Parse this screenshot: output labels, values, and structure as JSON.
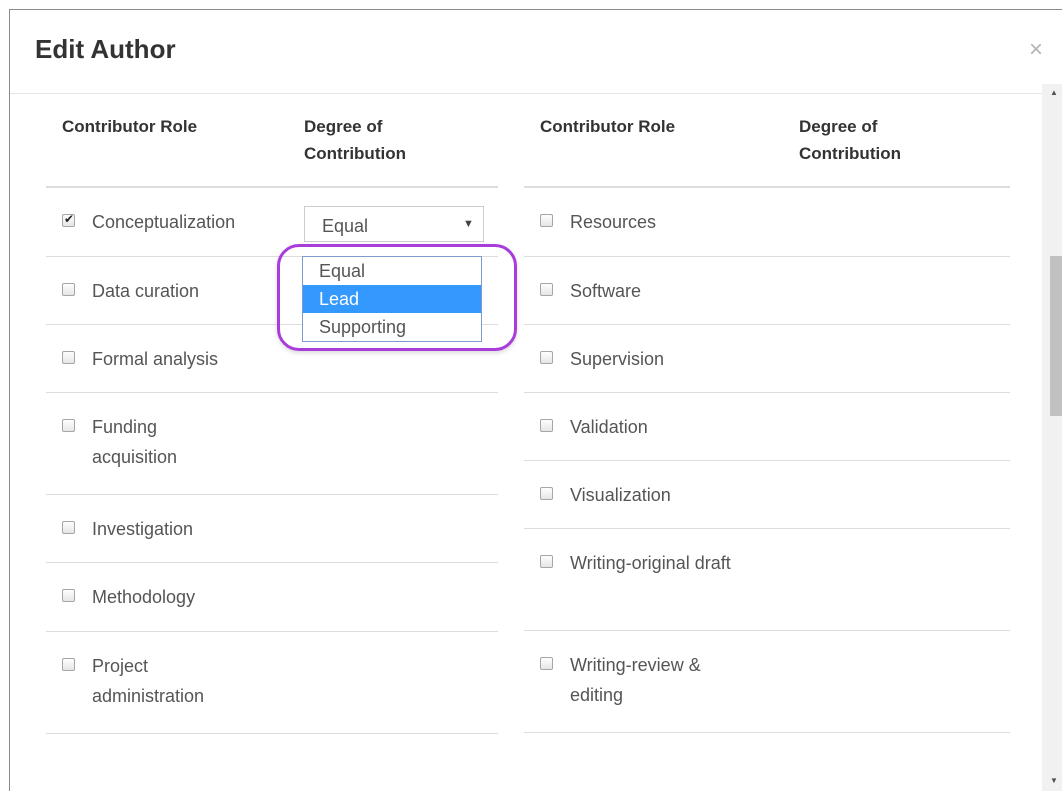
{
  "dialog": {
    "title": "Edit Author",
    "close_icon": "×"
  },
  "table": {
    "role_header": "Contributor Role",
    "degree_header": "Degree of Contribution"
  },
  "left_roles": [
    {
      "label": "Conceptualization",
      "checked": true
    },
    {
      "label": "Data curation",
      "checked": false
    },
    {
      "label": "Formal analysis",
      "checked": false
    },
    {
      "label": "Funding acquisition",
      "checked": false
    },
    {
      "label": "Investigation",
      "checked": false
    },
    {
      "label": "Methodology",
      "checked": false
    },
    {
      "label": "Project administration",
      "checked": false
    }
  ],
  "right_roles": [
    {
      "label": "Resources",
      "checked": false
    },
    {
      "label": "Software",
      "checked": false
    },
    {
      "label": "Supervision",
      "checked": false
    },
    {
      "label": "Validation",
      "checked": false
    },
    {
      "label": "Visualization",
      "checked": false
    },
    {
      "label": "Writing-original draft",
      "checked": false
    },
    {
      "label": "Writing-review & editing",
      "checked": false
    }
  ],
  "degree_select": {
    "value": "Equal",
    "options": [
      "Equal",
      "Lead",
      "Supporting"
    ],
    "highlighted": "Lead"
  },
  "colors": {
    "highlight_ring": "#a93ddb",
    "option_selected": "#3399ff"
  }
}
